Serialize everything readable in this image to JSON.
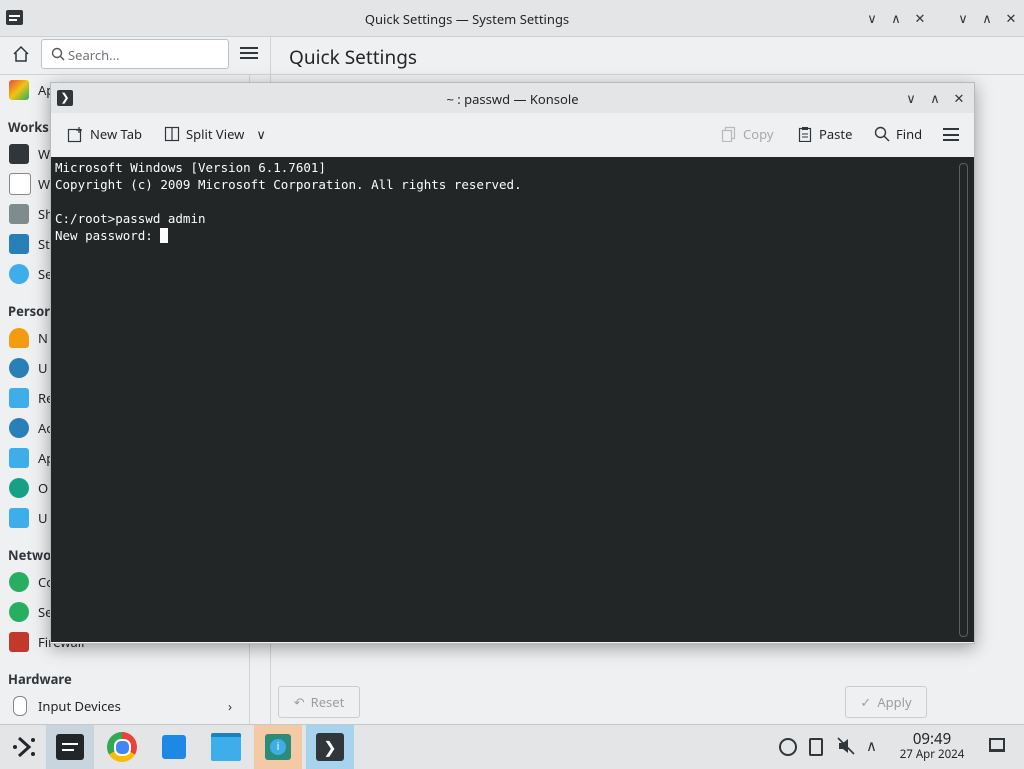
{
  "settings_window": {
    "title": "Quick Settings — System Settings",
    "search_placeholder": "Search...",
    "page_title": "Quick Settings",
    "sidebar": {
      "top_item": "Ap",
      "sections": [
        {
          "header": "Works",
          "items": [
            "W",
            "W",
            "Sh",
            "St",
            "Se"
          ]
        },
        {
          "header": "Persor",
          "items": [
            "N",
            "U",
            "Re",
            "Ac",
            "Ap",
            "O",
            "U"
          ]
        },
        {
          "header": "Netwo",
          "items": [
            "Cc",
            "Se",
            "Firewall"
          ]
        },
        {
          "header": "Hardware",
          "items": [
            "Input Devices"
          ]
        }
      ]
    },
    "reset_label": "Reset",
    "apply_label": "Apply"
  },
  "konsole": {
    "title": "~ : passwd — Konsole",
    "toolbar": {
      "new_tab": "New Tab",
      "split_view": "Split View",
      "copy": "Copy",
      "paste": "Paste",
      "find": "Find"
    },
    "terminal_lines": [
      "Microsoft Windows [Version 6.1.7601]",
      "Copyright (c) 2009 Microsoft Corporation. All rights reserved.",
      "",
      "C:/root>passwd admin",
      "New password: "
    ]
  },
  "taskbar": {
    "apps": [
      "application-launcher",
      "system-settings",
      "chrome",
      "discover",
      "file-manager",
      "info-center",
      "konsole"
    ],
    "clock_time": "09:49",
    "clock_date": "27 Apr 2024"
  },
  "colors": {
    "terminal_bg": "#232627",
    "terminal_fg": "#fcfcfc",
    "window_bg": "#eff0f1",
    "accent": "#3daee9"
  }
}
